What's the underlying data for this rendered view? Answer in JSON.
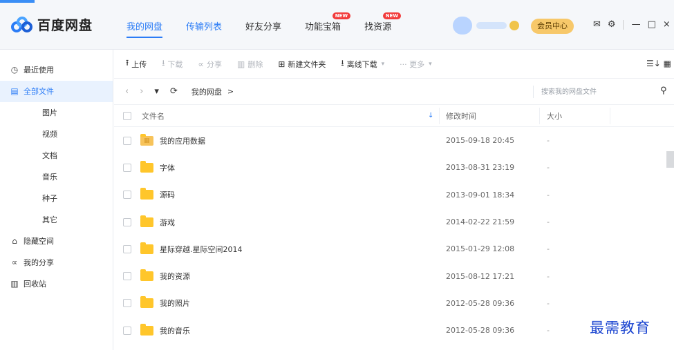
{
  "app": {
    "title": "百度网盘"
  },
  "nav": {
    "items": [
      {
        "label": "我的网盘",
        "active": true,
        "blue": true,
        "badge": ""
      },
      {
        "label": "传输列表",
        "active": false,
        "blue": true,
        "badge": ""
      },
      {
        "label": "好友分享",
        "active": false,
        "blue": false,
        "badge": ""
      },
      {
        "label": "功能宝箱",
        "active": false,
        "blue": false,
        "badge": "NEW"
      },
      {
        "label": "找资源",
        "active": false,
        "blue": false,
        "badge": "NEW"
      }
    ]
  },
  "header": {
    "vip_label": "会员中心"
  },
  "icons": {
    "mail": "✉",
    "settings": "⚙",
    "minimize": "—",
    "maximize": "□",
    "close": "×"
  },
  "sidebar": {
    "items": [
      {
        "key": "recent",
        "label": "最近使用",
        "icon": "◷",
        "sub": false,
        "active": false
      },
      {
        "key": "all",
        "label": "全部文件",
        "icon": "▤",
        "sub": false,
        "active": true
      },
      {
        "key": "pictures",
        "label": "图片",
        "icon": "",
        "sub": true,
        "active": false
      },
      {
        "key": "videos",
        "label": "视频",
        "icon": "",
        "sub": true,
        "active": false
      },
      {
        "key": "docs",
        "label": "文档",
        "icon": "",
        "sub": true,
        "active": false
      },
      {
        "key": "music",
        "label": "音乐",
        "icon": "",
        "sub": true,
        "active": false
      },
      {
        "key": "torrents",
        "label": "种子",
        "icon": "",
        "sub": true,
        "active": false
      },
      {
        "key": "other",
        "label": "其它",
        "icon": "",
        "sub": true,
        "active": false
      },
      {
        "key": "hidden",
        "label": "隐藏空间",
        "icon": "⌂",
        "sub": false,
        "active": false
      },
      {
        "key": "shares",
        "label": "我的分享",
        "icon": "∝",
        "sub": false,
        "active": false
      },
      {
        "key": "trash",
        "label": "回收站",
        "icon": "▥",
        "sub": false,
        "active": false
      }
    ]
  },
  "toolbar": {
    "upload": "上传",
    "download": "下载",
    "share": "分享",
    "delete": "删除",
    "new_folder": "新建文件夹",
    "offline_download": "离线下载",
    "more": "··· 更多",
    "view_icons": "☰↓ ▦"
  },
  "path": {
    "crumb": "我的网盘",
    "crumb_sep": ">",
    "search_placeholder": "搜索我的网盘文件"
  },
  "table": {
    "headers": {
      "name": "文件名",
      "time": "修改时间",
      "size": "大小"
    },
    "rows": [
      {
        "name": "我的应用数据",
        "time": "2015-09-18 20:45",
        "size": "-",
        "app": true
      },
      {
        "name": "字体",
        "time": "2013-08-31 23:19",
        "size": "-",
        "app": false
      },
      {
        "name": "源码",
        "time": "2013-09-01 18:34",
        "size": "-",
        "app": false
      },
      {
        "name": "游戏",
        "time": "2014-02-22 21:59",
        "size": "-",
        "app": false
      },
      {
        "name": "星际穿越.星际空间2014",
        "time": "2015-01-29 12:08",
        "size": "-",
        "app": false
      },
      {
        "name": "我的资源",
        "time": "2015-08-12 17:21",
        "size": "-",
        "app": false
      },
      {
        "name": "我的照片",
        "time": "2012-05-28 09:36",
        "size": "-",
        "app": false
      },
      {
        "name": "我的音乐",
        "time": "2012-05-28 09:36",
        "size": "-",
        "app": false
      }
    ]
  },
  "watermark": "最需教育"
}
